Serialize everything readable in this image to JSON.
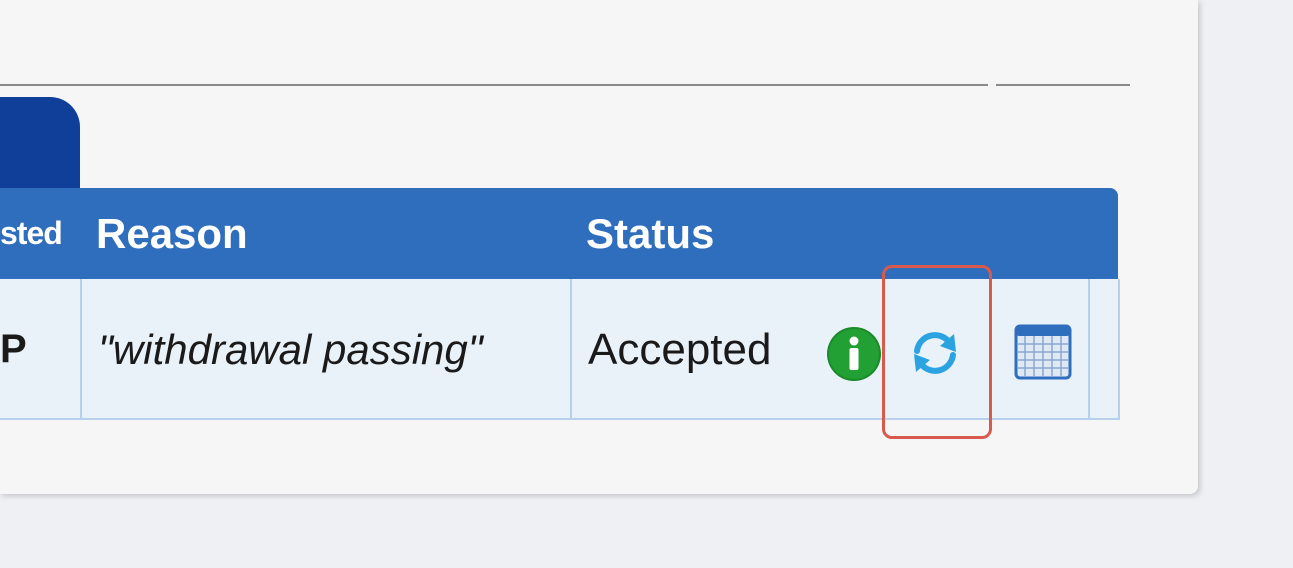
{
  "table": {
    "headers": {
      "requested": "sted",
      "reason": "Reason",
      "status": "Status"
    },
    "row": {
      "first_cell": "P",
      "reason": "\"withdrawal passing\"",
      "status": "Accepted"
    }
  },
  "icons": {
    "info": "info-icon",
    "refresh": "refresh-icon",
    "calendar": "calendar-icon"
  },
  "colors": {
    "header_bg": "#2f6dbd",
    "tab_bg": "#0f3f98",
    "row_bg": "#e9f1f9",
    "info_green": "#1a8a2a",
    "refresh_blue": "#2aa3e0",
    "highlight_red": "#d85a4c"
  }
}
